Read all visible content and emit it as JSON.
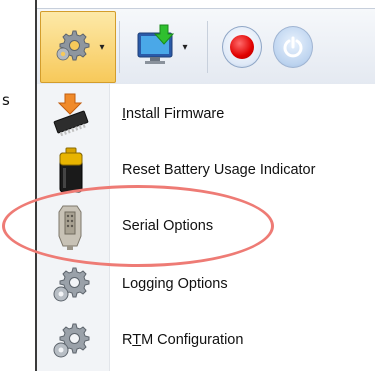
{
  "background_text": {
    "line1": "s"
  },
  "toolbar": {
    "settings_icon": "gear-icon",
    "download_icon": "monitor-download-icon",
    "record_icon": "record-icon",
    "power_icon": "power-icon",
    "dropdown_arrow": "▾"
  },
  "menu": {
    "items": [
      {
        "label_prefix": "",
        "label_underlined": "I",
        "label_rest": "nstall Firmware",
        "icon": "chip-download-icon"
      },
      {
        "label_prefix": "",
        "label_underlined": "",
        "label_rest": "Reset Battery Usage Indicator",
        "icon": "battery-icon"
      },
      {
        "label_prefix": "",
        "label_underlined": "",
        "label_rest": "Serial Options",
        "icon": "serial-connector-icon"
      },
      {
        "label_prefix": "",
        "label_underlined": "",
        "label_rest": "Logging Options",
        "icon": "gear-icon"
      },
      {
        "label_prefix": "R",
        "label_underlined": "T",
        "label_rest": "M Configuration",
        "icon": "gear-icon"
      }
    ]
  },
  "colors": {
    "highlight_ellipse": "#ee7b75",
    "settings_button_bg": "#f7c95a",
    "record_red": "#e00000"
  }
}
